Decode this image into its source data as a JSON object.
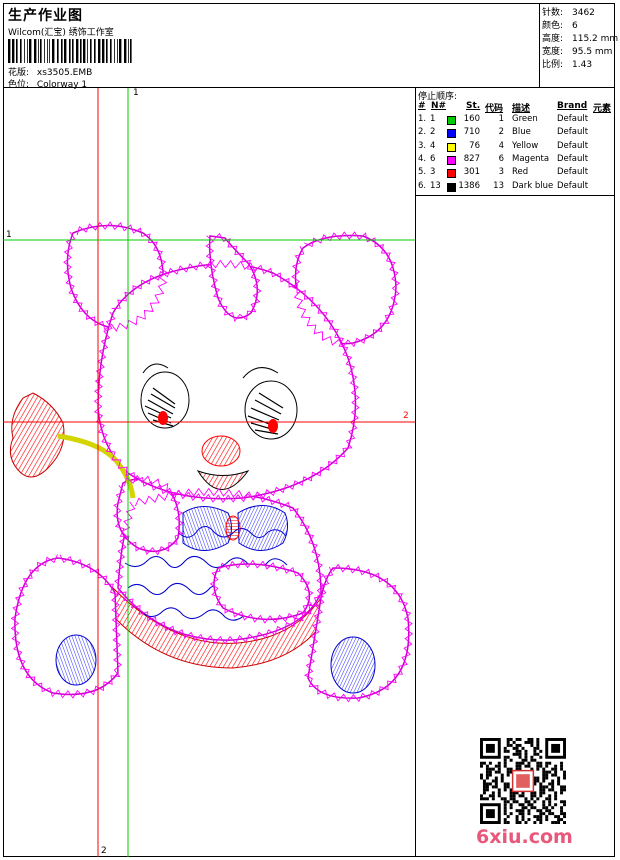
{
  "header": {
    "title": "生产作业图",
    "company": "Wilcom(汇宝) 绣饰工作室",
    "design_label": "花版:",
    "design_value": "xs3505.EMB",
    "colorway_label": "色位:",
    "colorway_value": "Colorway 1"
  },
  "stats": [
    {
      "label": "针数:",
      "value": "3462"
    },
    {
      "label": "颜色:",
      "value": "6"
    },
    {
      "label": "高度:",
      "value": "115.2 mm"
    },
    {
      "label": "宽度:",
      "value": "95.5 mm"
    },
    {
      "label": "比例:",
      "value": "1.43"
    }
  ],
  "stop_sequence": {
    "title": "停止顺序:",
    "headers": {
      "num": "#",
      "no": "N#",
      "st": "St.",
      "code": "代码",
      "desc": "描述",
      "brand": "Brand",
      "element": "元素"
    },
    "rows": [
      {
        "index": "1.",
        "n": "1",
        "color": "#00cc00",
        "stitches": "160",
        "code": "1",
        "desc": "Green",
        "brand": "Default"
      },
      {
        "index": "2.",
        "n": "2",
        "color": "#0000ff",
        "stitches": "710",
        "code": "2",
        "desc": "Blue",
        "brand": "Default"
      },
      {
        "index": "3.",
        "n": "4",
        "color": "#ffff00",
        "stitches": "76",
        "code": "4",
        "desc": "Yellow",
        "brand": "Default"
      },
      {
        "index": "4.",
        "n": "6",
        "color": "#ff00ff",
        "stitches": "827",
        "code": "6",
        "desc": "Magenta",
        "brand": "Default"
      },
      {
        "index": "5.",
        "n": "3",
        "color": "#ff0000",
        "stitches": "301",
        "code": "3",
        "desc": "Red",
        "brand": "Default"
      },
      {
        "index": "6.",
        "n": "13",
        "color": "#000000",
        "stitches": "1386",
        "code": "13",
        "desc": "Dark blue",
        "brand": "Default"
      }
    ]
  },
  "guides": {
    "v1": "1",
    "v2": "2",
    "h1": "1",
    "h2": "2",
    "vertical_color": "#ff0000",
    "vertical2_color": "#00cc00"
  },
  "watermark": "6xiu.com",
  "palette": {
    "outline": "#cc00cc",
    "stitch": "#ff00ff",
    "blue": "#0000cc",
    "red": "#ff0000",
    "yellow": "#ffff00",
    "line": "#000000"
  }
}
